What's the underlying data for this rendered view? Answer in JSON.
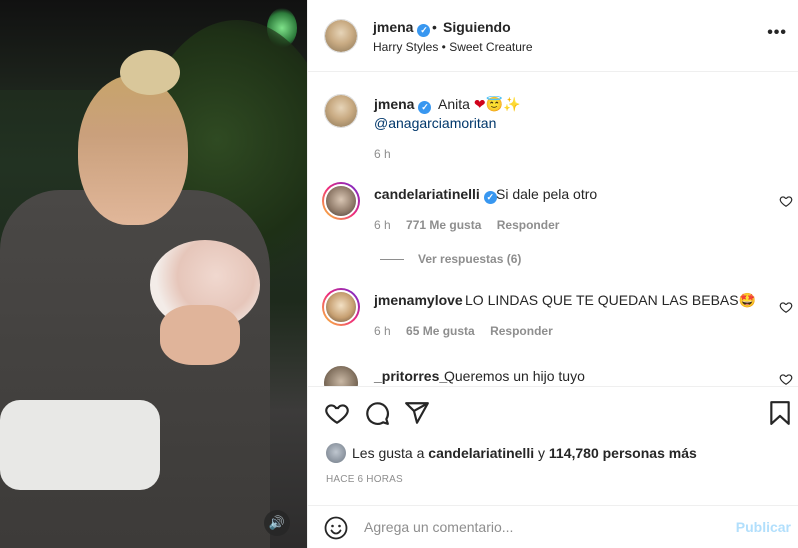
{
  "post": {
    "author": "jmena",
    "follow_status": "Siguiendo",
    "separator": "•",
    "music": "Harry Styles • Sweet Creature",
    "more": "•••"
  },
  "caption": {
    "username": "jmena",
    "text": "Anita ",
    "emojis": [
      "❤",
      "😇",
      "✨"
    ],
    "mention": "@anagarciamoritan",
    "time": "6 h"
  },
  "comments": [
    {
      "username": "candelariatinelli",
      "verified": true,
      "text": "Si dale pela otro",
      "time": "6 h",
      "likes": "771 Me gusta",
      "reply": "Responder"
    },
    {
      "username": "jmenamylove",
      "verified": false,
      "text": "LO LINDAS QUE TE QUEDAN LAS BEBAS",
      "emoji": "🤩",
      "time": "6 h",
      "likes": "65 Me gusta",
      "reply": "Responder"
    },
    {
      "username": "_pritorres_",
      "verified": false,
      "text": "Queremos un hijo tuyo"
    }
  ],
  "view_replies": "Ver respuestas (6)",
  "likes": {
    "prefix": "Les gusta a ",
    "user": "candelariatinelli",
    "middle": " y ",
    "count": "114,780 personas más"
  },
  "timestamp": "HACE 6 HORAS",
  "add_comment": {
    "placeholder": "Agrega un comentario...",
    "post_label": "Publicar"
  },
  "media": {
    "audio_icon": "🔊"
  },
  "colors": {
    "verified": "#3897f0",
    "link": "#00376b",
    "muted": "#8e8e8e",
    "post_disabled": "#b2dffc"
  }
}
